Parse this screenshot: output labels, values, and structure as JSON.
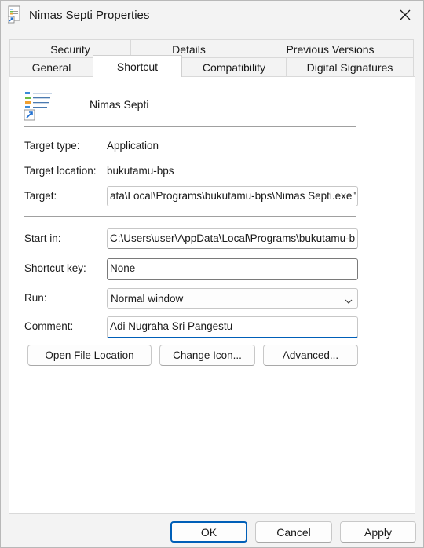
{
  "window": {
    "title": "Nimas Septi Properties",
    "app_icon": "shortcut-document-icon",
    "close_icon": "close-icon"
  },
  "tabs": {
    "row1": [
      "Security",
      "Details",
      "Previous Versions"
    ],
    "row2": [
      "General",
      "Shortcut",
      "Compatibility",
      "Digital Signatures"
    ],
    "active": "Shortcut"
  },
  "shortcut": {
    "icon": "app-logo-icon",
    "name": "Nimas Septi",
    "target_type_label": "Target type:",
    "target_type_value": "Application",
    "target_location_label": "Target location:",
    "target_location_value": "bukutamu-bps",
    "target_label": "Target:",
    "target_value": "ata\\Local\\Programs\\bukutamu-bps\\Nimas Septi.exe\"",
    "start_in_label": "Start in:",
    "start_in_value": "C:\\Users\\user\\AppData\\Local\\Programs\\bukutamu-b",
    "shortcut_key_label": "Shortcut key:",
    "shortcut_key_value": "None",
    "run_label": "Run:",
    "run_value": "Normal window",
    "comment_label": "Comment:",
    "comment_value": "Adi Nugraha Sri Pangestu"
  },
  "panel_buttons": {
    "open_file_location": "Open File Location",
    "change_icon": "Change Icon...",
    "advanced": "Advanced..."
  },
  "dialog_buttons": {
    "ok": "OK",
    "cancel": "Cancel",
    "apply": "Apply"
  },
  "colors": {
    "accent": "#005fb8",
    "panel_bg": "#ffffff",
    "window_bg": "#f3f3f3"
  }
}
